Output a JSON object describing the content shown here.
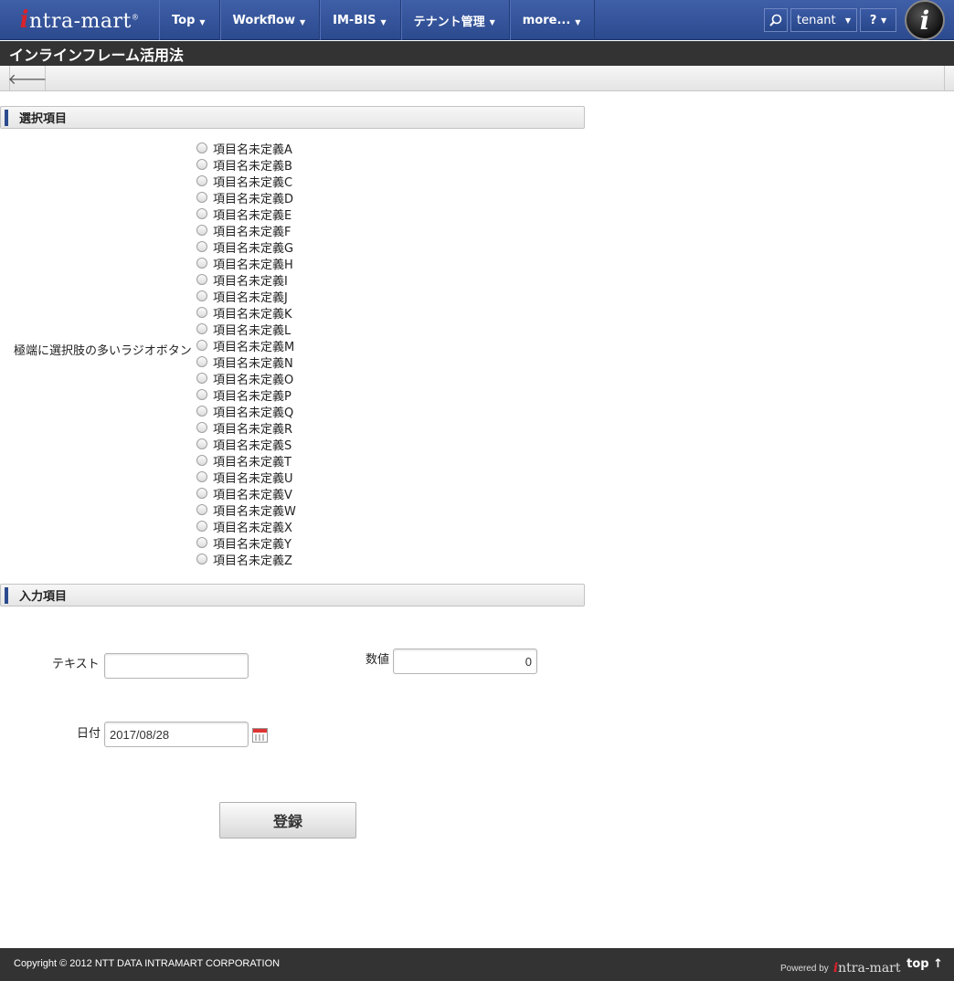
{
  "nav": {
    "logo_text": "ntra-mart",
    "logo_mark": "i",
    "logo_reg": "®",
    "items": [
      {
        "label": "Top"
      },
      {
        "label": "Workflow"
      },
      {
        "label": "IM-BIS"
      },
      {
        "label": "テナント管理"
      },
      {
        "label": "more..."
      }
    ],
    "tenant_label": "tenant",
    "help_label": "?",
    "avatar_mark": "i",
    "search_icon": "search-icon",
    "caret": "▼"
  },
  "page_title": "インラインフレーム活用法",
  "toolbar": {
    "back_icon": "🡐"
  },
  "section1": {
    "title": "選択項目",
    "radio_label": "極端に選択肢の多いラジオボタン",
    "options": [
      "項目名未定義A",
      "項目名未定義B",
      "項目名未定義C",
      "項目名未定義D",
      "項目名未定義E",
      "項目名未定義F",
      "項目名未定義G",
      "項目名未定義H",
      "項目名未定義I",
      "項目名未定義J",
      "項目名未定義K",
      "項目名未定義L",
      "項目名未定義M",
      "項目名未定義N",
      "項目名未定義O",
      "項目名未定義P",
      "項目名未定義Q",
      "項目名未定義R",
      "項目名未定義S",
      "項目名未定義T",
      "項目名未定義U",
      "項目名未定義V",
      "項目名未定義W",
      "項目名未定義X",
      "項目名未定義Y",
      "項目名未定義Z"
    ]
  },
  "section2": {
    "title": "入力項目",
    "text_label": "テキスト",
    "text_value": "",
    "number_label": "数値",
    "number_value": "0",
    "date_label": "日付",
    "date_value": "2017/08/28",
    "submit_label": "登録"
  },
  "footer": {
    "copyright": "Copyright © 2012 NTT DATA INTRAMART CORPORATION",
    "powered_by": "Powered by",
    "powered_logo": "ntra-mart",
    "powered_mark": "i",
    "top_link": "top ↑"
  }
}
